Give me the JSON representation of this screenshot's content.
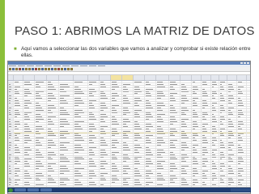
{
  "colors": {
    "accent": "#8bbf3a",
    "bullet": "#7fb035",
    "title": "#3a3a3a"
  },
  "slide": {
    "title": "PASO 1: ABRIMOS LA MATRIZ DE DATOS",
    "bullet_icon": "square-bullet-icon",
    "bullet_text": "Aquí vamos a seleccionar las dos variables que vamos a analizar y comprobar si existe relación entre ellas."
  },
  "screenshot": {
    "description_icon": "spreadsheet-window-icon",
    "highlighted_columns": [
      9,
      10
    ]
  }
}
